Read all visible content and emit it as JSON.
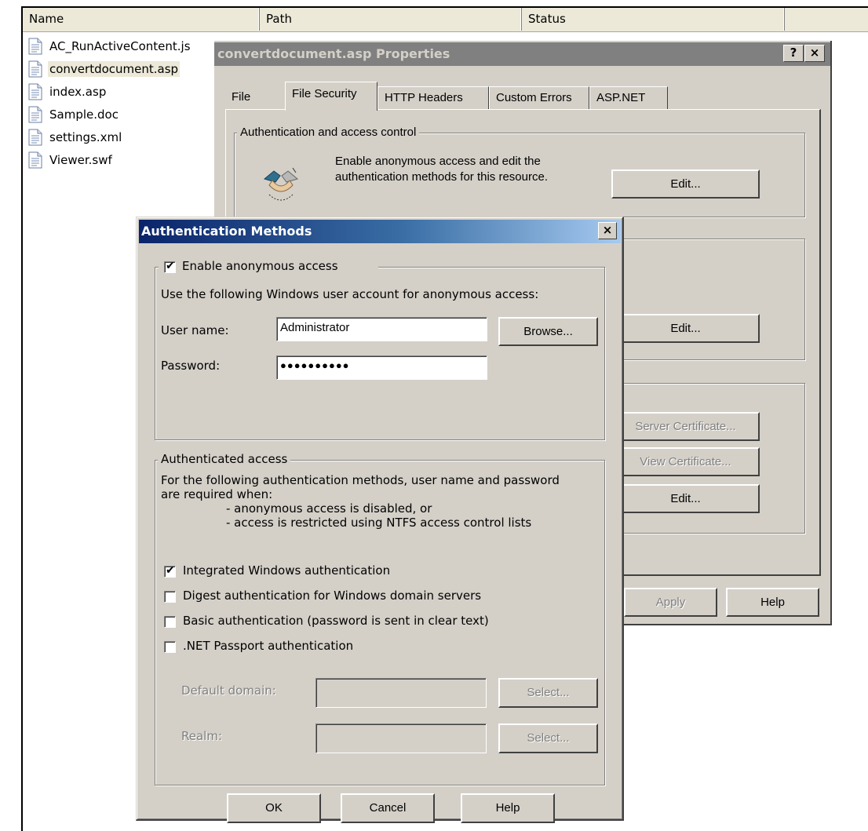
{
  "list": {
    "columns": [
      "Name",
      "Path",
      "Status"
    ],
    "files": [
      {
        "name": "AC_RunActiveContent.js",
        "selected": false
      },
      {
        "name": "convertdocument.asp",
        "selected": true
      },
      {
        "name": "index.asp",
        "selected": false
      },
      {
        "name": "Sample.doc",
        "selected": false
      },
      {
        "name": "settings.xml",
        "selected": false
      },
      {
        "name": "Viewer.swf",
        "selected": false
      }
    ]
  },
  "properties": {
    "title": "convertdocument.asp Properties",
    "help_button": "?",
    "close_button": "×",
    "tabs": [
      "File",
      "File Security",
      "HTTP Headers",
      "Custom Errors",
      "ASP.NET"
    ],
    "active_tab": "File Security",
    "auth_group_title": "Authentication and access control",
    "auth_desc_line1": "Enable anonymous access and edit the",
    "auth_desc_line2": "authentication methods for this resource.",
    "edit_label": "Edit...",
    "ip_edit_label": "Edit...",
    "server_cert_label": "Server Certificate...",
    "view_cert_label": "View Certificate...",
    "comm_edit_label": "Edit...",
    "apply_label": "Apply",
    "help_label": "Help"
  },
  "auth_dialog": {
    "title": "Authentication Methods",
    "close_button": "×",
    "enable_anonymous_label": "Enable anonymous access",
    "enable_anonymous_checked": true,
    "account_prompt": "Use the following Windows user account for anonymous access:",
    "username_label": "User name:",
    "username_value": "Administrator",
    "browse_label": "Browse...",
    "password_label": "Password:",
    "password_value": "●●●●●●●●●●",
    "authenticated_group_title": "Authenticated access",
    "auth_note_1": "For the following authentication methods, user name and password",
    "auth_note_2": "are required when:",
    "auth_note_3": "- anonymous access is disabled, or",
    "auth_note_4": "- access is restricted using NTFS access control lists",
    "methods": [
      {
        "label": "Integrated Windows authentication",
        "checked": true
      },
      {
        "label": "Digest authentication for Windows domain servers",
        "checked": false
      },
      {
        "label": "Basic authentication (password is sent in clear text)",
        "checked": false
      },
      {
        "label": ".NET Passport authentication",
        "checked": false
      }
    ],
    "default_domain_label": "Default domain:",
    "default_domain_value": "",
    "realm_label": "Realm:",
    "realm_value": "",
    "select_label": "Select...",
    "ok_label": "OK",
    "cancel_label": "Cancel",
    "help_label": "Help"
  }
}
